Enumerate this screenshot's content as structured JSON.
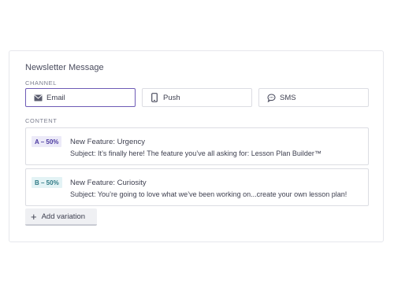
{
  "card": {
    "title": "Newsletter Message"
  },
  "channel": {
    "label": "CHANNEL",
    "options": [
      {
        "label": "Email",
        "icon": "mail-icon",
        "selected": true
      },
      {
        "label": "Push",
        "icon": "phone-icon",
        "selected": false
      },
      {
        "label": "SMS",
        "icon": "chat-bubble-icon",
        "selected": false
      }
    ]
  },
  "content": {
    "label": "CONTENT",
    "variations": [
      {
        "badge": "A – 50%",
        "title": "New Feature: Urgency",
        "subject": "Subject: It’s finally here! The feature you’ve all asking for: Lesson Plan Builder™"
      },
      {
        "badge": "B – 50%",
        "title": "New Feature: Curiosity",
        "subject": "Subject: You’re going to love what we’ve been working on...create your own lesson plan!"
      }
    ],
    "add_label": "Add variation"
  },
  "colors": {
    "accent": "#6e5bb6",
    "badge_a_bg": "#eceaf8",
    "badge_b_bg": "#e3f3f5"
  }
}
